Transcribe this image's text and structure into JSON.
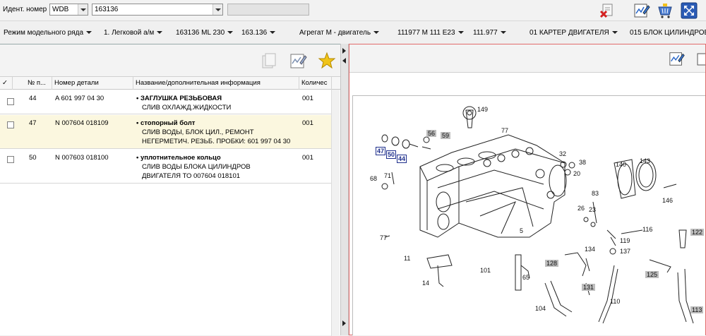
{
  "topbar": {
    "ident_label": "Идент. номер",
    "prefix_value": "WDB",
    "ident_value": "163136",
    "tools": [
      "delete-icon",
      "edit-notes-icon",
      "basket-icon",
      "fullscreen-icon"
    ]
  },
  "breadcrumbs": [
    "Режим модельного ряда",
    "1. Легковой а/м",
    "163136 ML 230",
    "163.136",
    "Агрегат М  - двигатель",
    "111977 M 111 E23",
    "111.977",
    "01 КАРТЕР ДВИГАТЕЛЯ",
    "015 БЛОК ЦИЛИНДРОВ"
  ],
  "table": {
    "headers": [
      "✓",
      "№ п...",
      "Номер детали",
      "Название/дополнительная информация",
      "Количес"
    ],
    "rows": [
      {
        "pos": "44",
        "part": "A 601 997 04 30",
        "name": "ЗАГЛУШКА РЕЗЬБОВАЯ",
        "info": [
          "СЛИВ ОХЛАЖД.ЖИДКОСТИ"
        ],
        "qty": "001"
      },
      {
        "pos": "47",
        "part": "N 007604 018109",
        "name": "стопорный болт",
        "info": [
          "СЛИВ ВОДЫ, БЛОК ЦИЛ., РЕМОНТ",
          "НЕГЕРМЕТИЧ. РЕЗЬБ. ПРОБКИ: 601 997 04 30"
        ],
        "qty": "001"
      },
      {
        "pos": "50",
        "part": "N 007603 018100",
        "name": "уплотнительное кольцо",
        "info": [
          "СЛИВ ВОДЫ БЛОКА ЦИЛИНДРОВ",
          "ДВИГАТЕЛЯ ТО 007604 018101"
        ],
        "qty": "001"
      }
    ]
  },
  "diagram": {
    "labels": {
      "l149": "149",
      "l77a": "77",
      "l56": "56",
      "l59": "59",
      "l47": "47",
      "l50": "50",
      "l44": "44",
      "l32": "32",
      "l38": "38",
      "l20": "20",
      "l140": "140",
      "l143": "143",
      "l71": "71",
      "l68": "68",
      "l83": "83",
      "l26": "26",
      "l23": "23",
      "l146": "146",
      "l5": "5",
      "l116": "116",
      "l122": "122",
      "l77b": "77",
      "l119": "119",
      "l134": "134",
      "l137": "137",
      "l11": "11",
      "l128": "128",
      "l101": "101",
      "l65": "65",
      "l125": "125",
      "l131": "131",
      "l14": "14",
      "l110": "110",
      "l104": "104",
      "l113": "113"
    }
  },
  "colors": {
    "highlight": "#1e2f8c",
    "selected_row": "#fbf7df",
    "panel_border": "#e16a6a"
  }
}
